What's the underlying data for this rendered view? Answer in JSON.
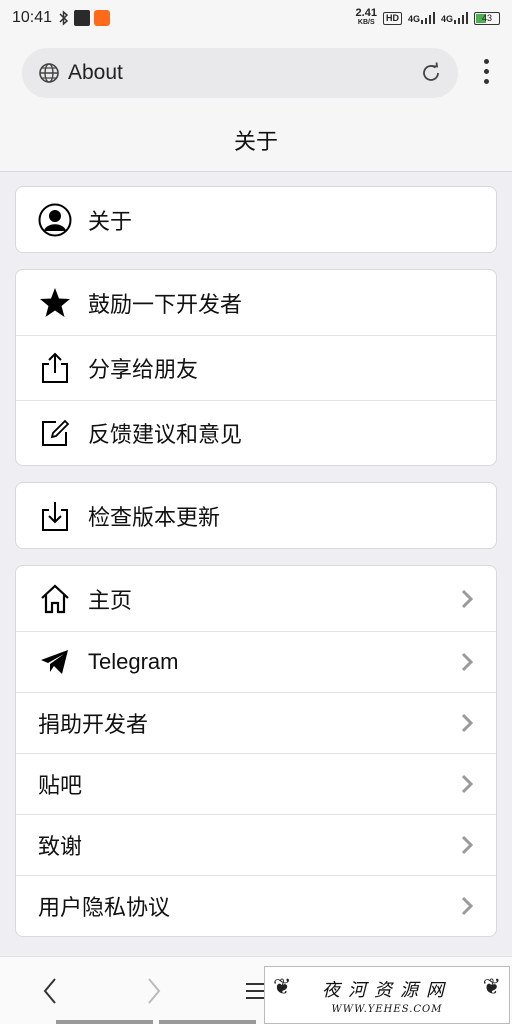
{
  "status_bar": {
    "time": "10:41",
    "speed_value": "2.41",
    "speed_unit": "KB/S",
    "hd_badge": "HD",
    "network1": "4G",
    "network2": "4G",
    "battery": "43"
  },
  "browser": {
    "url_text": "About"
  },
  "page": {
    "title": "关于"
  },
  "groups": [
    {
      "items": [
        {
          "label": "关于",
          "icon": "user-circle-icon"
        }
      ]
    },
    {
      "items": [
        {
          "label": "鼓励一下开发者",
          "icon": "star-icon"
        },
        {
          "label": "分享给朋友",
          "icon": "share-icon"
        },
        {
          "label": "反馈建议和意见",
          "icon": "edit-icon"
        }
      ]
    },
    {
      "items": [
        {
          "label": "检查版本更新",
          "icon": "download-icon"
        }
      ]
    },
    {
      "items": [
        {
          "label": "主页",
          "icon": "home-icon"
        },
        {
          "label": "Telegram",
          "icon": "telegram-icon"
        },
        {
          "label": "捐助开发者"
        },
        {
          "label": "贴吧"
        },
        {
          "label": "致谢"
        },
        {
          "label": "用户隐私协议"
        }
      ]
    }
  ],
  "watermark": {
    "main": "夜河资源网",
    "sub": "WWW.YEHES.COM"
  },
  "colors": {
    "accent": "#000000",
    "chevron": "#9a9a9a",
    "background": "#eeeef3"
  }
}
